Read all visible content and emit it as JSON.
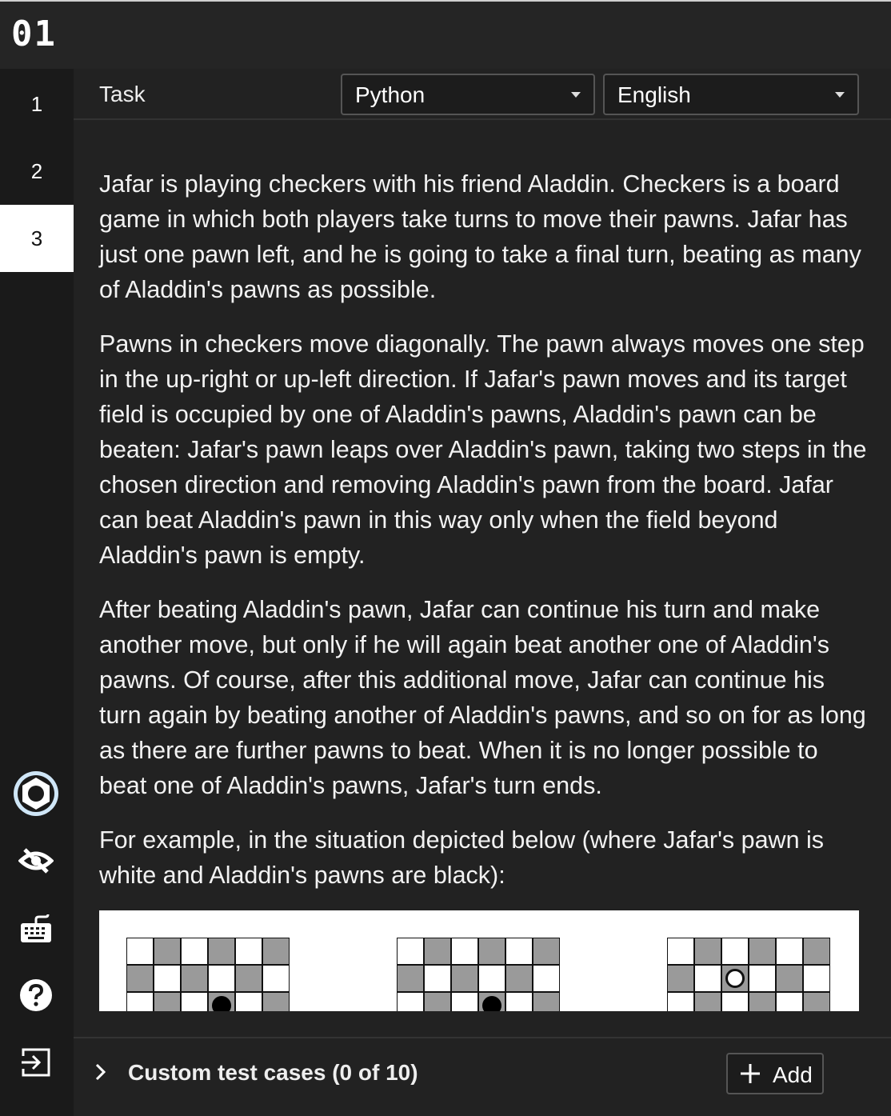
{
  "app": {
    "logo": "01"
  },
  "sidebar": {
    "items": [
      {
        "label": "1"
      },
      {
        "label": "2"
      },
      {
        "label": "3",
        "active": true
      }
    ],
    "icons": [
      "settings-icon",
      "visibility-icon",
      "keyboard-icon",
      "help-icon",
      "exit-icon"
    ]
  },
  "taskbar": {
    "task_label": "Task",
    "language_select": "Python",
    "locale_select": "English"
  },
  "content": {
    "paragraphs": [
      "Jafar is playing checkers with his friend Aladdin. Checkers is a board game in which both players take turns to move their pawns. Jafar has just one pawn left, and he is going to take a final turn, beating as many of Aladdin's pawns as possible.",
      "Pawns in checkers move diagonally. The pawn always moves one step in the up-right or up-left direction. If Jafar's pawn moves and its target field is occupied by one of Aladdin's pawns, Aladdin's pawn can be beaten: Jafar's pawn leaps over Aladdin's pawn, taking two steps in the chosen direction and removing Aladdin's pawn from the board. Jafar can beat Aladdin's pawn in this way only when the field beyond Aladdin's pawn is empty.",
      "After beating Aladdin's pawn, Jafar can continue his turn and make another move, but only if he will again beat another one of Aladdin's pawns. Of course, after this additional move, Jafar can continue his turn again by beating another of Aladdin's pawns, and so on for as long as there are further pawns to beat. When it is no longer possible to beat one of Aladdin's pawns, Jafar's turn ends.",
      "For example, in the situation depicted below (where Jafar's pawn is white and Aladdin's pawns are black):"
    ]
  },
  "figure": {
    "boards": [
      {
        "pawns": [
          {
            "row": 2,
            "col": 3,
            "color": "black"
          }
        ]
      },
      {
        "pawns": [
          {
            "row": 2,
            "col": 3,
            "color": "black"
          }
        ]
      },
      {
        "pawns": [
          {
            "row": 1,
            "col": 2,
            "color": "white"
          }
        ]
      }
    ]
  },
  "footer": {
    "custom_tests_label": "Custom test cases (0 of 10)",
    "add_label": "Add"
  },
  "colors": {
    "background": "#1e1e1e",
    "sidebar": "#1a1a1a",
    "active_nav": "#ffffff",
    "text": "#f2f2f2",
    "board_dark": "#9a9a9a",
    "board_light": "#ffffff"
  }
}
